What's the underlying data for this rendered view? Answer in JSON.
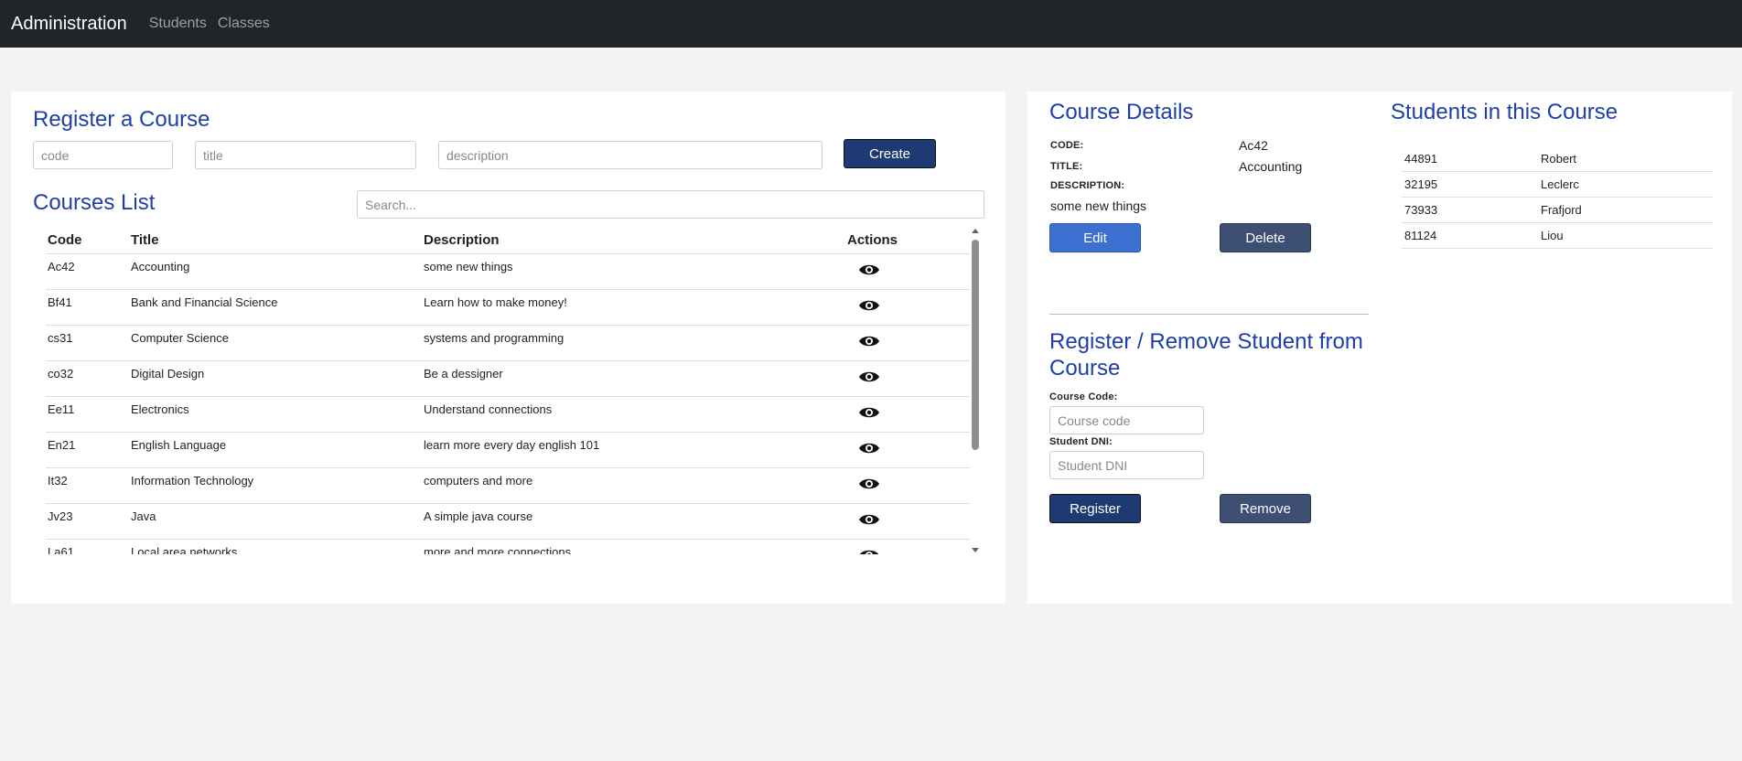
{
  "nav": {
    "brand": "Administration",
    "links": [
      "Students",
      "Classes"
    ]
  },
  "register_course": {
    "title": "Register a Course",
    "code_placeholder": "code",
    "title_placeholder": "title",
    "description_placeholder": "description",
    "create_label": "Create"
  },
  "courses_list": {
    "title": "Courses List",
    "search_placeholder": "Search...",
    "headers": [
      "Code",
      "Title",
      "Description",
      "Actions"
    ],
    "rows": [
      {
        "code": "Ac42",
        "title": "Accounting",
        "description": "some new things"
      },
      {
        "code": "Bf41",
        "title": "Bank and Financial Science",
        "description": "Learn how to make money!"
      },
      {
        "code": "cs31",
        "title": "Computer Science",
        "description": "systems and programming"
      },
      {
        "code": "co32",
        "title": "Digital Design",
        "description": "Be a dessigner"
      },
      {
        "code": "Ee11",
        "title": "Electronics",
        "description": "Understand connections"
      },
      {
        "code": "En21",
        "title": "English Language",
        "description": "learn more every day english 101"
      },
      {
        "code": "It32",
        "title": "Information Technology",
        "description": "computers and more"
      },
      {
        "code": "Jv23",
        "title": "Java",
        "description": "A simple java course"
      },
      {
        "code": "La61",
        "title": "Local area networks",
        "description": "more and more connections"
      }
    ]
  },
  "course_details": {
    "title": "Course Details",
    "code_label": "CODE:",
    "code_value": "Ac42",
    "title_label": "TITLE:",
    "title_value": "Accounting",
    "description_label": "DESCRIPTION:",
    "description_value": "some new things",
    "edit_label": "Edit",
    "delete_label": "Delete"
  },
  "students_in_course": {
    "title": "Students in this Course",
    "students": [
      {
        "dni": "44891",
        "name": "Robert"
      },
      {
        "dni": "32195",
        "name": "Leclerc"
      },
      {
        "dni": "73933",
        "name": "Frafjord"
      },
      {
        "dni": "81124",
        "name": "Liou"
      }
    ]
  },
  "register_student": {
    "title": "Register / Remove Student from Course",
    "course_code_label": "Course Code:",
    "course_code_placeholder": "Course code",
    "student_dni_label": "Student DNI:",
    "student_dni_placeholder": "Student DNI",
    "register_label": "Register",
    "remove_label": "Remove"
  },
  "colors": {
    "accent_heading": "#1f3fa8",
    "navbar_bg": "#212529",
    "primary_dark": "#1e3a73",
    "edit_blue": "#3d6fd0",
    "slate": "#3d4f72"
  },
  "icons": {
    "view_action": "eye-icon"
  }
}
